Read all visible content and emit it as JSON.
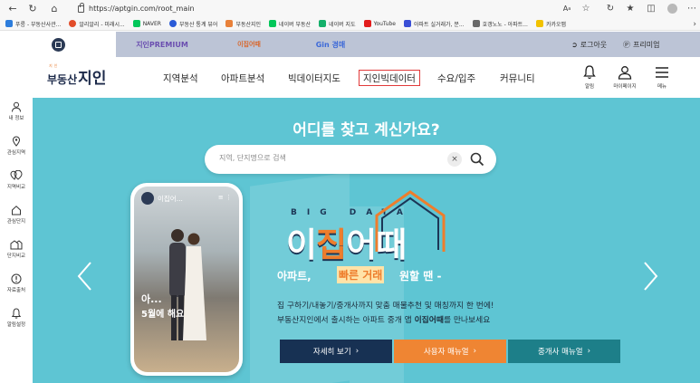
{
  "browser": {
    "url": "https://aptgin.com/root_main",
    "bookmarks": [
      {
        "label": "푸릉 - 부동산사관...",
        "color": "#2d7ddc"
      },
      {
        "label": "알리알리 - 미래시...",
        "color": "#e24d2a"
      },
      {
        "label": "NAVER",
        "color": "#03c75a"
      },
      {
        "label": "부동산 통계 뷰어",
        "color": "#2a5bd7"
      },
      {
        "label": "부동산지인",
        "color": "#e8813a"
      },
      {
        "label": "네이버 부동산",
        "color": "#03c75a"
      },
      {
        "label": "네이버 지도",
        "color": "#14b06a"
      },
      {
        "label": "YouTube",
        "color": "#e21c1c"
      },
      {
        "label": "아파트 실거래가, 분...",
        "color": "#3a4fd6"
      },
      {
        "label": "호갱노노 - 아파트...",
        "color": "#6a6a6a"
      },
      {
        "label": "카카오맵",
        "color": "#f2c200"
      }
    ]
  },
  "service_tabs": {
    "premium": "지인PREMIUM",
    "izipeo": "이집어때",
    "gin": "Gin 경매"
  },
  "auth": {
    "logout": "로그아웃",
    "premium": "프리미엄"
  },
  "header": {
    "logo_top": "지인",
    "logo_a": "부동산",
    "logo_b": "지인",
    "menu": [
      "지역분석",
      "아파트분석",
      "빅데이터지도",
      "지인빅데이터",
      "수요/입주",
      "커뮤니티"
    ],
    "icons": {
      "alarm": "알림",
      "mypage": "마이페이지",
      "menu": "메뉴"
    }
  },
  "sidebar": [
    {
      "label": "내 정보",
      "icon": "person-icon"
    },
    {
      "label": "관심지역",
      "icon": "location-pin-icon"
    },
    {
      "label": "지역비교",
      "icon": "compare-icon"
    },
    {
      "label": "관심단지",
      "icon": "home-icon"
    },
    {
      "label": "단지비교",
      "icon": "buildings-icon"
    },
    {
      "label": "자료출처",
      "icon": "info-icon"
    },
    {
      "label": "알림설정",
      "icon": "bell-icon"
    }
  ],
  "hero": {
    "title": "어디를 찾고 계신가요?",
    "search_placeholder": "지역, 단지명으로 검색",
    "phone_app_name": "이집어...",
    "phone_caption_1": "아...",
    "phone_caption_2": "5월에 해요",
    "bigdata": "BIG DATA",
    "brand_a": "이",
    "brand_b": "집",
    "brand_c": "어때",
    "tag_a": "아파트,",
    "tag_b": "빠른 거래",
    "tag_c": "원할 땐 -",
    "line1": "집 구하기/내놓기/중개사까지 맞춤 매물추천 및 매칭까지 한 번에!",
    "line2_pre": "부동산지인에서 출시하는 아파트 중개 앱 ",
    "line2_bold": "이집어때",
    "line2_post": "를 만나보세요",
    "buttons": {
      "detail": "자세히 보기",
      "user": "사용자 매뉴얼",
      "agent": "중개사 매뉴얼"
    }
  },
  "colors": {
    "hero_bg": "#5ec5d3",
    "navy": "#173153",
    "orange": "#ef8533",
    "teal": "#1d7f89",
    "highlight_border": "#e23a3a"
  }
}
